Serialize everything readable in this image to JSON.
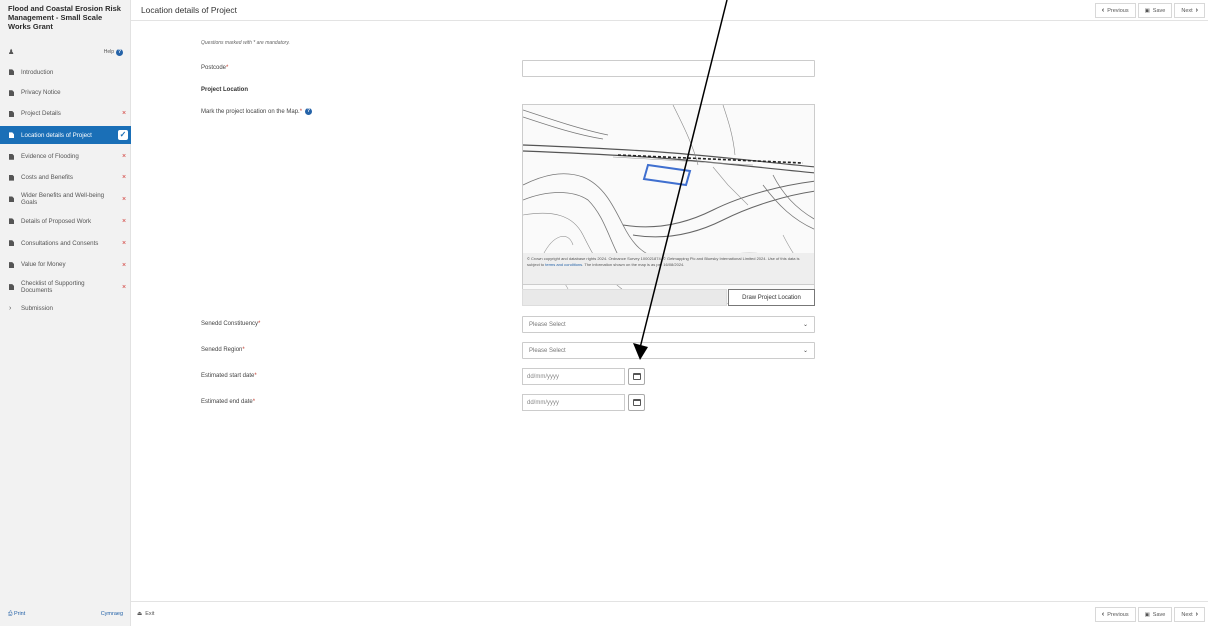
{
  "app": {
    "title": "Flood and Coastal Erosion Risk Management - Small Scale Works Grant",
    "help_label": "Help",
    "print_label": "Print",
    "language_label": "Cymraeg"
  },
  "sidebar": {
    "items": [
      {
        "label": "Introduction",
        "status": ""
      },
      {
        "label": "Privacy Notice",
        "status": ""
      },
      {
        "label": "Project Details",
        "status": "×"
      },
      {
        "label": "Location details of Project",
        "status": "✓"
      },
      {
        "label": "Evidence of Flooding",
        "status": "×"
      },
      {
        "label": "Costs and Benefits",
        "status": "×"
      },
      {
        "label": "Wider Benefits and Well-being Goals",
        "status": "×"
      },
      {
        "label": "Details of Proposed Work",
        "status": "×"
      },
      {
        "label": "Consultations and Consents",
        "status": "×"
      },
      {
        "label": "Value for Money",
        "status": "×"
      },
      {
        "label": "Checklist of Supporting Documents",
        "status": "×"
      },
      {
        "label": "Submission",
        "status": ""
      }
    ]
  },
  "header": {
    "title": "Location details of Project",
    "previous_label": "Previous",
    "save_label": "Save",
    "next_label": "Next"
  },
  "form": {
    "mandatory_note": "Questions marked with * are mandatory.",
    "postcode_label": "Postcode",
    "postcode_value": "",
    "project_location_heading": "Project Location",
    "map_label": "Mark the project location on the Map.",
    "map_copyright": "© Crown copyright and database rights 2024. Ordnance Survey 100021874. © Getmapping Plc and Bluesky International Limited 2024. Use of this data is subject to",
    "map_copyright_link": "terms and conditions",
    "map_copyright_tail": ". The information shown on the map is as per 16/08/2024.",
    "draw_button": "Draw Project Location",
    "senedd_constituency_label": "Senedd Constituency",
    "senedd_constituency_value": "Please Select",
    "senedd_region_label": "Senedd Region",
    "senedd_region_value": "Please Select",
    "start_date_label": "Estimated start date",
    "start_date_placeholder": "dd/mm/yyyy",
    "end_date_label": "Estimated end date",
    "end_date_placeholder": "dd/mm/yyyy",
    "required_marker": "*"
  },
  "footer": {
    "exit_label": "Exit",
    "previous_label": "Previous",
    "save_label": "Save",
    "next_label": "Next"
  },
  "colors": {
    "accent": "#1a6fb7",
    "error": "#d0312d",
    "selection_polygon": "#3f6fcf"
  }
}
